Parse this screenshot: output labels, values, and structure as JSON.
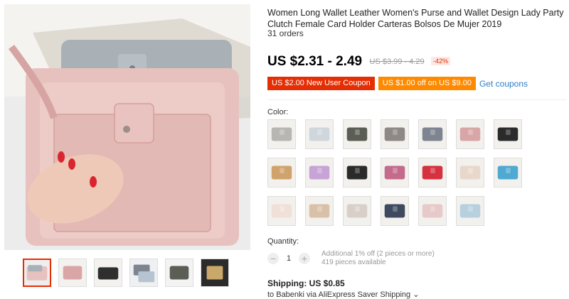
{
  "product": {
    "title": "Women Long Wallet Leather Women's Purse and Wallet Design Lady Party Clutch Female Card Holder Carteras Bolsos De Mujer 2019",
    "orders": "31 orders"
  },
  "price": {
    "current": "US $2.31 - 2.49",
    "original": "US $3.99 - 4.29",
    "discount": "-42%"
  },
  "coupons": {
    "new_user": "US $2.00 New User Coupon",
    "off": "US $1.00 off on US $9.00",
    "get_coupons": "Get coupons"
  },
  "color": {
    "label": "Color:",
    "swatch_colors": [
      "#b8b6b3",
      "#cfd6dc",
      "#5b5e54",
      "#8e8887",
      "#7e8490",
      "#d9a6a8",
      "#2b2b2b",
      "#cfa36b",
      "#c8a3d6",
      "#2a2a2a",
      "#c46b8b",
      "#d6313f",
      "#e8d8cc",
      "#4fa9d2",
      "#f0e0d8",
      "#d8c1a8",
      "#d8cfc8",
      "#3f4a60",
      "#e6c9c8",
      "#b6d0de"
    ]
  },
  "quantity": {
    "label": "Quantity:",
    "minus": "−",
    "plus": "+",
    "value": "1",
    "additional_off": "Additional 1% off (2 pieces or more)",
    "available": "419 pieces available"
  },
  "shipping": {
    "label": "Shipping: US $0.85",
    "to": "to Babenki via AliExpress Saver Shipping ⌄"
  }
}
